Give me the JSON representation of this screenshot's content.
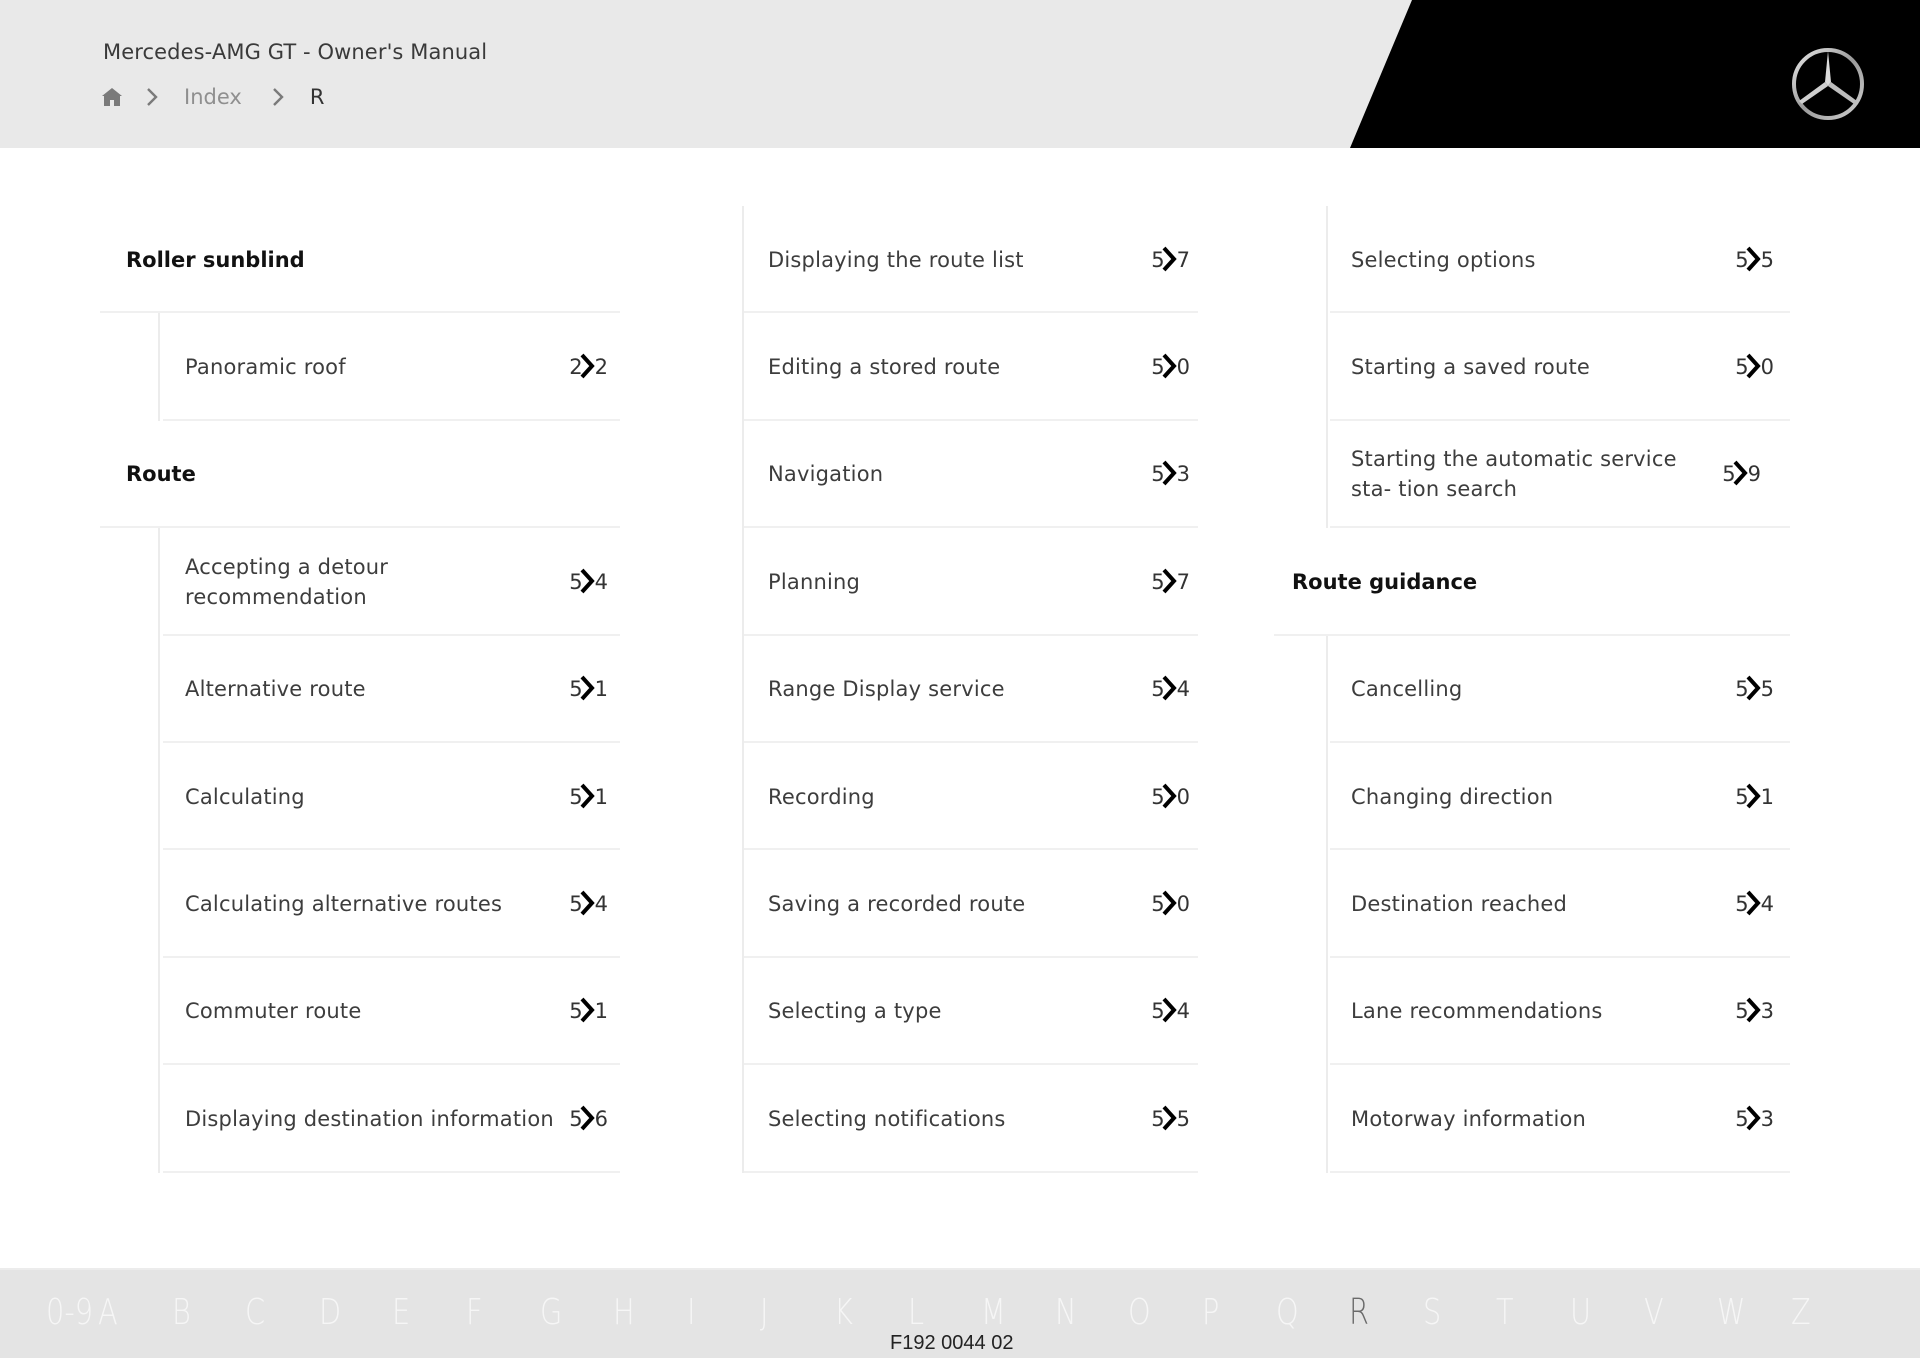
{
  "header": {
    "title": "Mercedes-AMG GT - Owner's Manual",
    "breadcrumb": {
      "home_icon": "home-icon",
      "items": [
        "Index",
        "R"
      ]
    },
    "logo": "mercedes-star-logo",
    "colors": {
      "header_bg": "#e9e9e9",
      "brand_black": "#000000"
    }
  },
  "columns": [
    {
      "blocks": [
        {
          "heading": "Roller sunblind",
          "items": [
            {
              "label": "Panoramic roof",
              "page_first": "2",
              "page_last": "2"
            }
          ]
        },
        {
          "heading": "Route",
          "items": [
            {
              "label": "Accepting a detour recommendation",
              "page_first": "5",
              "page_last": "4"
            },
            {
              "label": "Alternative route",
              "page_first": "5",
              "page_last": "1"
            },
            {
              "label": "Calculating",
              "page_first": "5",
              "page_last": "1"
            },
            {
              "label": "Calculating alternative routes",
              "page_first": "5",
              "page_last": "4"
            },
            {
              "label": "Commuter route",
              "page_first": "5",
              "page_last": "1"
            },
            {
              "label": "Displaying destination information",
              "page_first": "5",
              "page_last": "6"
            }
          ]
        }
      ]
    },
    {
      "blocks": [
        {
          "heading": "",
          "items": [
            {
              "label": "Displaying the route list",
              "page_first": "5",
              "page_last": "7"
            },
            {
              "label": "Editing a stored route",
              "page_first": "5",
              "page_last": "0"
            },
            {
              "label": "Navigation",
              "page_first": "5",
              "page_last": "3"
            },
            {
              "label": "Planning",
              "page_first": "5",
              "page_last": "7"
            },
            {
              "label": "Range Display service",
              "page_first": "5",
              "page_last": "4"
            },
            {
              "label": "Recording",
              "page_first": "5",
              "page_last": "0"
            },
            {
              "label": "Saving a recorded route",
              "page_first": "5",
              "page_last": "0"
            },
            {
              "label": "Selecting a type",
              "page_first": "5",
              "page_last": "4"
            },
            {
              "label": "Selecting notifications",
              "page_first": "5",
              "page_last": "5"
            }
          ]
        }
      ]
    },
    {
      "blocks": [
        {
          "heading": "",
          "items": [
            {
              "label": "Selecting options",
              "page_first": "5",
              "page_last": "5"
            },
            {
              "label": "Starting a saved route",
              "page_first": "5",
              "page_last": "0"
            },
            {
              "label": "Starting the automatic service sta- tion search",
              "page_first": "5",
              "page_last": "9"
            }
          ]
        },
        {
          "heading": "Route guidance",
          "items": [
            {
              "label": "Cancelling",
              "page_first": "5",
              "page_last": "5"
            },
            {
              "label": "Changing direction",
              "page_first": "5",
              "page_last": "1"
            },
            {
              "label": "Destination reached",
              "page_first": "5",
              "page_last": "4"
            },
            {
              "label": "Lane recommendations",
              "page_first": "5",
              "page_last": "3"
            },
            {
              "label": "Motorway information",
              "page_first": "5",
              "page_last": "3"
            }
          ]
        }
      ]
    }
  ],
  "footer": {
    "alphabet": [
      "0-9",
      "A",
      "B",
      "C",
      "D",
      "E",
      "F",
      "G",
      "H",
      "I",
      "J",
      "K",
      "L",
      "M",
      "N",
      "O",
      "P",
      "Q",
      "R",
      "S",
      "T",
      "U",
      "V",
      "W",
      "Z"
    ],
    "active_letter": "R",
    "doc_code": "F192 0044 02"
  }
}
